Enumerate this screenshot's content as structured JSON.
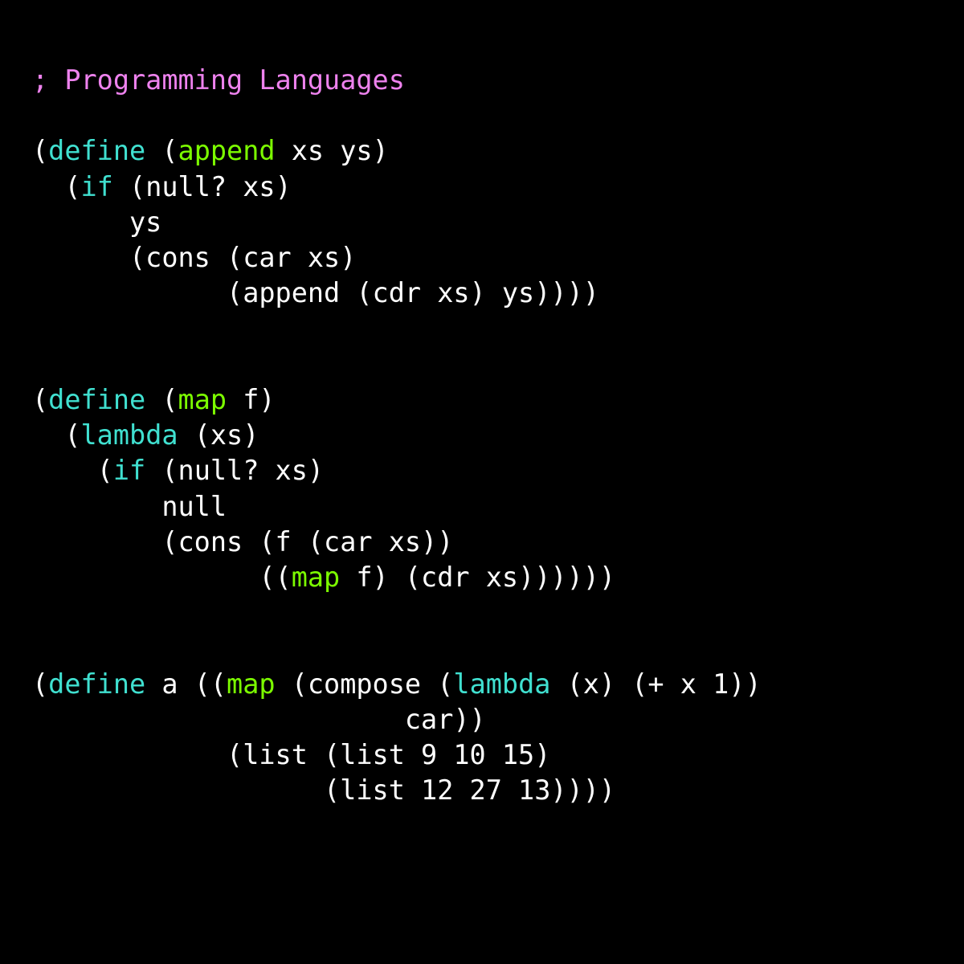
{
  "colors": {
    "background": "#000000",
    "default": "#ffffff",
    "comment": "#ee82ee",
    "keyword": "#40e0d0",
    "function": "#7cfc00"
  },
  "tokens": {
    "comment_line": "; Programming Languages",
    "define": "define",
    "append": "append",
    "xs_ys": " xs ys)",
    "if": "if",
    "null_q_xs": " (null? xs)",
    "ys_line": "      ys",
    "cons_car_xs": "      (cons (car xs)",
    "append_cdr": "            (append (cdr xs) ys))))",
    "map": "map",
    "f_close": " f)",
    "lambda": "lambda",
    "xs_close": " (xs)",
    "null_q_xs2": " (null? xs)",
    "null_line": "        null",
    "cons_f_car": "        (cons (f (car xs))",
    "map_f": " f) (cdr xs))))))",
    "a_space": " a ((",
    "compose_open": " (compose (",
    "lambda_body": " (x) (+ x 1))",
    "car_close": "                       car))",
    "list1": "            (list (list 9 10 15)",
    "list2": "                  (list 12 27 13))))"
  },
  "raw_source": "; Programming Languages\n\n(define (append xs ys)\n  (if (null? xs)\n      ys\n      (cons (car xs)\n            (append (cdr xs) ys))))\n\n\n(define (map f)\n  (lambda (xs)\n    (if (null? xs)\n        null\n        (cons (f (car xs))\n              ((map f) (cdr xs))))))\n\n\n(define a ((map (compose (lambda (x) (+ x 1))\n                       car))\n            (list (list 9 10 15)\n                  (list 12 27 13))))"
}
